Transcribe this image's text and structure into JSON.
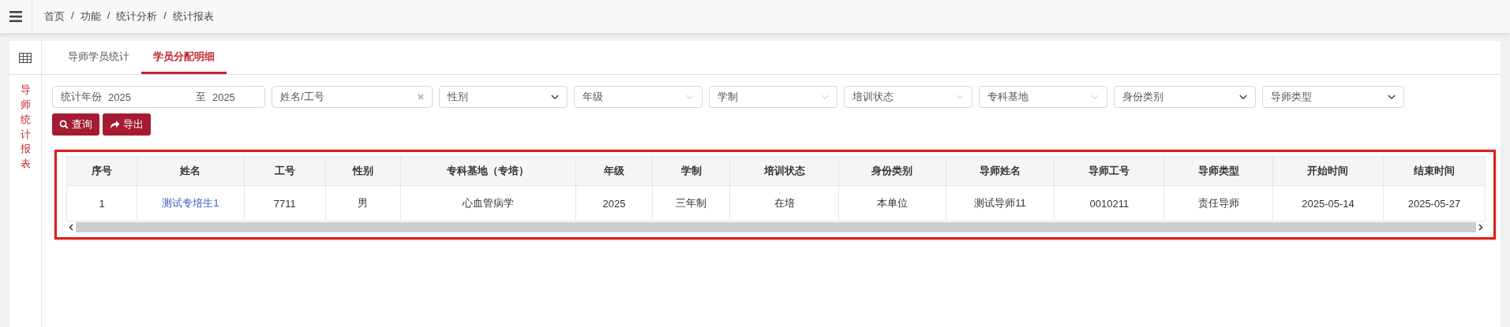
{
  "breadcrumb": {
    "separator": "/",
    "items": [
      "首页",
      "功能",
      "统计分析",
      "统计报表"
    ]
  },
  "sidebar": {
    "title": "导师统计报表"
  },
  "tabs": [
    {
      "label": "导师学员统计",
      "selected": false
    },
    {
      "label": "学员分配明细",
      "selected": true
    }
  ],
  "filters": {
    "year_range": {
      "label": "统计年份",
      "from": "2025",
      "separator": "至",
      "to": "2025"
    },
    "name_search": {
      "placeholder": "姓名/工号"
    },
    "dropdowns": [
      {
        "kind": "select",
        "placeholder": "性别"
      },
      {
        "kind": "combo",
        "placeholder": "年级"
      },
      {
        "kind": "combo",
        "placeholder": "学制"
      },
      {
        "kind": "combo",
        "placeholder": "培训状态"
      },
      {
        "kind": "combo",
        "placeholder": "专科基地"
      },
      {
        "kind": "select",
        "placeholder": "身份类别"
      },
      {
        "kind": "select",
        "placeholder": "导师类型"
      }
    ]
  },
  "buttons": [
    {
      "kind": "search",
      "label": "查询"
    },
    {
      "kind": "export",
      "label": "导出"
    }
  ],
  "table": {
    "columns": [
      "序号",
      "姓名",
      "工号",
      "性别",
      "专科基地（专培）",
      "年级",
      "学制",
      "培训状态",
      "身份类别",
      "导师姓名",
      "导师工号",
      "导师类型",
      "开始时间",
      "结束时间"
    ],
    "rows": [
      [
        "1",
        "测试专培生1",
        "7711",
        "男",
        "心血管病学",
        "2025",
        "三年制",
        "在培",
        "本单位",
        "测试导师11",
        "0010211",
        "责任导师",
        "2025-05-14",
        "2025-05-27"
      ]
    ]
  }
}
